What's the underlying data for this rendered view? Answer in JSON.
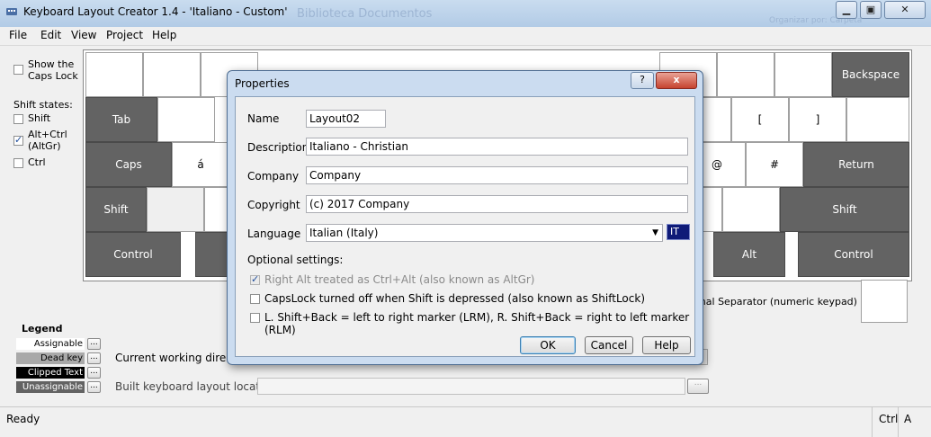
{
  "window": {
    "title": "Keyboard Layout Creator 1.4 - 'Italiano - Custom'",
    "bg_title": "Biblioteca Documentos",
    "bg_title_hint": "Organizar por: Carpeta"
  },
  "menu": [
    "File",
    "Edit",
    "View",
    "Project",
    "Help"
  ],
  "left_panel": {
    "show_caps_lock": "Show the Caps Lock",
    "shift_states_label": "Shift states:",
    "shift": "Shift",
    "altgr": "Alt+Ctrl (AltGr)",
    "ctrl": "Ctrl"
  },
  "keyboard": {
    "backspace": "Backspace",
    "tab": "Tab",
    "caps": "Caps",
    "shift_left": "Shift",
    "shift_right": "Shift",
    "control_left": "Control",
    "control_right": "Control",
    "alt_right": "Alt",
    "return": "Return",
    "a_acute": "á",
    "bracket_open": "[",
    "bracket_close": "]",
    "at": "@",
    "hash": "#",
    "decimal_separator": "imal Separator (numeric keypad)"
  },
  "legend": {
    "title": "Legend",
    "items": [
      {
        "label": "Assignable",
        "color": "#ffffff",
        "text": "#000000"
      },
      {
        "label": "Dead key",
        "color": "#a9a9a9",
        "text": "#000000"
      },
      {
        "label": "Clipped Text",
        "color": "#000000",
        "text": "#ffffff"
      },
      {
        "label": "Unassignable",
        "color": "#636363",
        "text": "#ffffff"
      }
    ],
    "ellipsis": "..."
  },
  "paths": {
    "working_dir": "Current working director",
    "built_location": "Built keyboard layout location"
  },
  "status": {
    "text": "Ready",
    "ctrl": "Ctrl",
    "a": "A"
  },
  "dialog": {
    "title": "Properties",
    "help_icon": "?",
    "close_icon": "x",
    "name_label": "Name",
    "name_value": "Layout02",
    "description_label": "Description",
    "description_value": "Italiano - Christian",
    "company_label": "Company",
    "company_value": "Company",
    "copyright_label": "Copyright",
    "copyright_value": "(c) 2017 Company",
    "language_label": "Language",
    "language_value": "Italian (Italy)",
    "language_code": "IT",
    "optional_label": "Optional settings:",
    "opt_altgr": "Right Alt treated as Ctrl+Alt (also known as AltGr)",
    "opt_shiftlock": "CapsLock turned off when Shift is depressed (also known as ShiftLock)",
    "opt_lrm": "L. Shift+Back = left to right marker (LRM),  R. Shift+Back = right to left marker (RLM)",
    "ok": "OK",
    "cancel": "Cancel",
    "help": "Help"
  }
}
